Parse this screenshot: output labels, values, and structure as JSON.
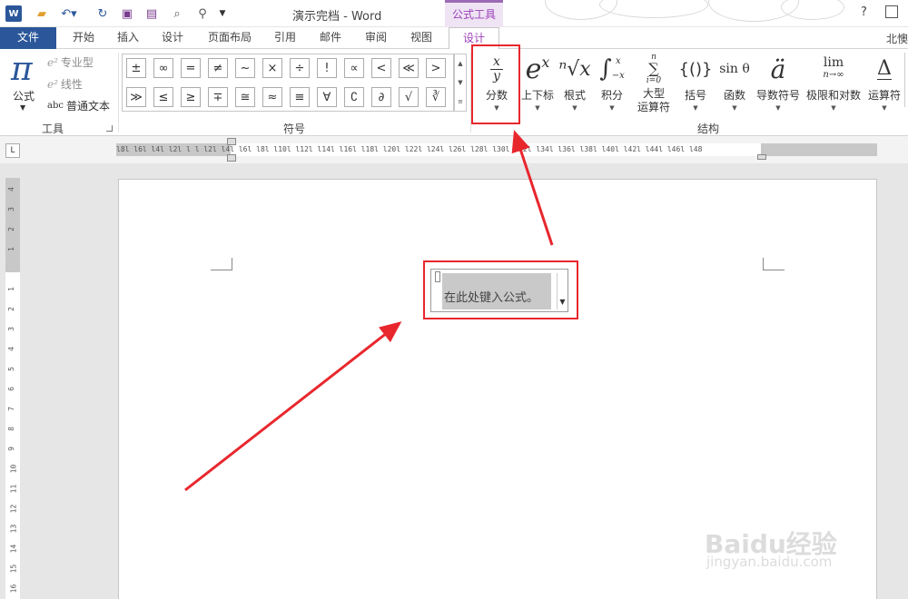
{
  "window": {
    "title": "演示完档 - Word",
    "context_tool": "公式工具",
    "help": "?",
    "user": "北懊",
    "app_logo": "W"
  },
  "quick_access": {
    "save_icon": "save-icon",
    "undo_icon": "undo-icon",
    "redo_icon": "redo-icon",
    "customize": "▼"
  },
  "tabs": [
    "文件",
    "开始",
    "插入",
    "设计",
    "页面布局",
    "引用",
    "邮件",
    "审阅",
    "视图",
    "设计"
  ],
  "ribbon": {
    "tools": {
      "formula_label": "公式",
      "professional": "专业型",
      "linear": "线性",
      "normal_text_prefix": "abc",
      "normal_text": "普通文本",
      "group_label": "工具"
    },
    "symbols": {
      "group_label": "符号",
      "row1": [
        "±",
        "∞",
        "=",
        "≠",
        "~",
        "×",
        "÷",
        "!",
        "∝",
        "<",
        "≪",
        ">"
      ],
      "row2": [
        "≫",
        "≤",
        "≥",
        "∓",
        "≅",
        "≈",
        "≡",
        "∀",
        "∁",
        "∂",
        "√",
        "∛"
      ]
    },
    "structures": {
      "group_label": "结构",
      "items": [
        {
          "label": "分数"
        },
        {
          "label": "上下标"
        },
        {
          "label": "根式"
        },
        {
          "label": "积分"
        },
        {
          "label": "大型\n运算符"
        },
        {
          "label": "括号"
        },
        {
          "label": "函数"
        },
        {
          "label": "导数符号"
        },
        {
          "label": "极限和对数"
        },
        {
          "label": "运算符"
        }
      ],
      "glyphs": {
        "fraction_num": "x",
        "fraction_den": "y",
        "script_base": "e",
        "script_sup": "x",
        "radical": "ⁿ√x",
        "integral_sym": "∫",
        "integral_upper": "x",
        "integral_lower": "−x",
        "large_op_top": "n",
        "large_op_sym": "∑",
        "large_op_bottom": "i=0",
        "bracket": "{()}",
        "function": "sin θ",
        "accent": "ä",
        "limit_top": "lim",
        "limit_bottom": "n→∞",
        "operator": "Δ"
      }
    }
  },
  "ruler": {
    "corner": "L",
    "h_ticks": "l8l l6l l4l l2l l  l l2l l4l l6l l8l l10l l12l l14l l16l l18l l20l l22l l24l l26l l28l l30l l32l l34l l36l l38l l40l l42l l44l l46l l48",
    "v_ticks": [
      "4",
      "3",
      "2",
      "1",
      "1",
      "2",
      "3",
      "4",
      "5",
      "6",
      "7",
      "8",
      "9",
      "10",
      "11",
      "12",
      "13",
      "14",
      "15",
      "16"
    ]
  },
  "document": {
    "equation_placeholder": "在此处键入公式。"
  },
  "watermark": {
    "logo": "Baidu经验",
    "url": "jingyan.baidu.com"
  },
  "colors": {
    "accent_purple": "#9b3fb8",
    "word_blue": "#2b579a",
    "annotation_red": "#e8272d"
  }
}
